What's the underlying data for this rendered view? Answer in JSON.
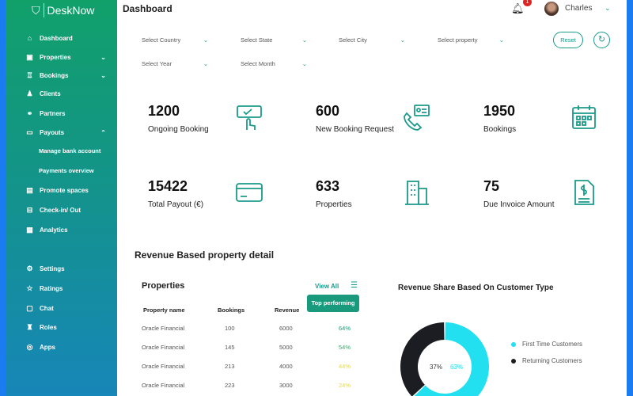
{
  "app": {
    "name": "DeskNow"
  },
  "sidebar": {
    "items": [
      {
        "label": "Dashboard",
        "icon": "home-icon"
      },
      {
        "label": "Properties",
        "icon": "building-icon",
        "chevron": "down"
      },
      {
        "label": "Bookings",
        "icon": "booking-icon",
        "chevron": "down"
      },
      {
        "label": "Clients",
        "icon": "user-icon"
      },
      {
        "label": "Partners",
        "icon": "handshake-icon"
      },
      {
        "label": "Payouts",
        "icon": "card-icon",
        "chevron": "up"
      },
      {
        "label": "Promote spaces",
        "icon": "promote-icon"
      },
      {
        "label": "Check-in/ Out",
        "icon": "checkin-icon"
      },
      {
        "label": "Analytics",
        "icon": "analytics-icon"
      },
      {
        "label": "Settings",
        "icon": "gear-icon"
      },
      {
        "label": "Ratings",
        "icon": "ratings-icon"
      },
      {
        "label": "Chat",
        "icon": "chat-icon"
      },
      {
        "label": "Roles",
        "icon": "roles-icon"
      },
      {
        "label": "Apps",
        "icon": "apps-icon"
      }
    ],
    "sub_items": [
      "Manage bank account",
      "Payments overview"
    ]
  },
  "header": {
    "title": "Dashboard",
    "notification_count": "1",
    "user": "Charles"
  },
  "filters": {
    "country": "Select Country",
    "state": "Select State",
    "city": "Select City",
    "property": "Select property",
    "year": "Select Year",
    "month": "Select Month",
    "reset": "Reset"
  },
  "stats": [
    {
      "value": "1200",
      "label": "Ongoing Booking"
    },
    {
      "value": "600",
      "label": "New Booking Request"
    },
    {
      "value": "1950",
      "label": "Bookings"
    },
    {
      "value": "15422",
      "label": "Total Payout  (€)"
    },
    {
      "value": "633",
      "label": "Properties"
    },
    {
      "value": "75",
      "label": "Due Invoice Amount"
    }
  ],
  "revenue_section": {
    "title": "Revenue Based property detail"
  },
  "properties": {
    "title": "Properties",
    "view_all": "View All",
    "tooltip": "Top performing",
    "columns": [
      "Property name",
      "Bookings",
      "Revenue"
    ],
    "rows": [
      {
        "name": "Oracle Financial",
        "bookings": "100",
        "revenue": "6000",
        "pct": "64%",
        "color": "#1a9a7c"
      },
      {
        "name": "Oracle Financial",
        "bookings": "145",
        "revenue": "5000",
        "pct": "54%",
        "color": "#3aa76a"
      },
      {
        "name": "Oracle Financial",
        "bookings": "213",
        "revenue": "4000",
        "pct": "44%",
        "color": "#e4d84a"
      },
      {
        "name": "Oracle Financial",
        "bookings": "223",
        "revenue": "3000",
        "pct": "24%",
        "color": "#e4d84a"
      }
    ]
  },
  "chart_data": {
    "type": "pie",
    "title": "Revenue Share Based On Customer Type",
    "categories": [
      "First Time Customers",
      "Returning Customers"
    ],
    "values": [
      63,
      37
    ],
    "labels": [
      "63%",
      "37%"
    ],
    "colors": [
      "#22e0f0",
      "#1c1d22"
    ],
    "legend": "right"
  }
}
